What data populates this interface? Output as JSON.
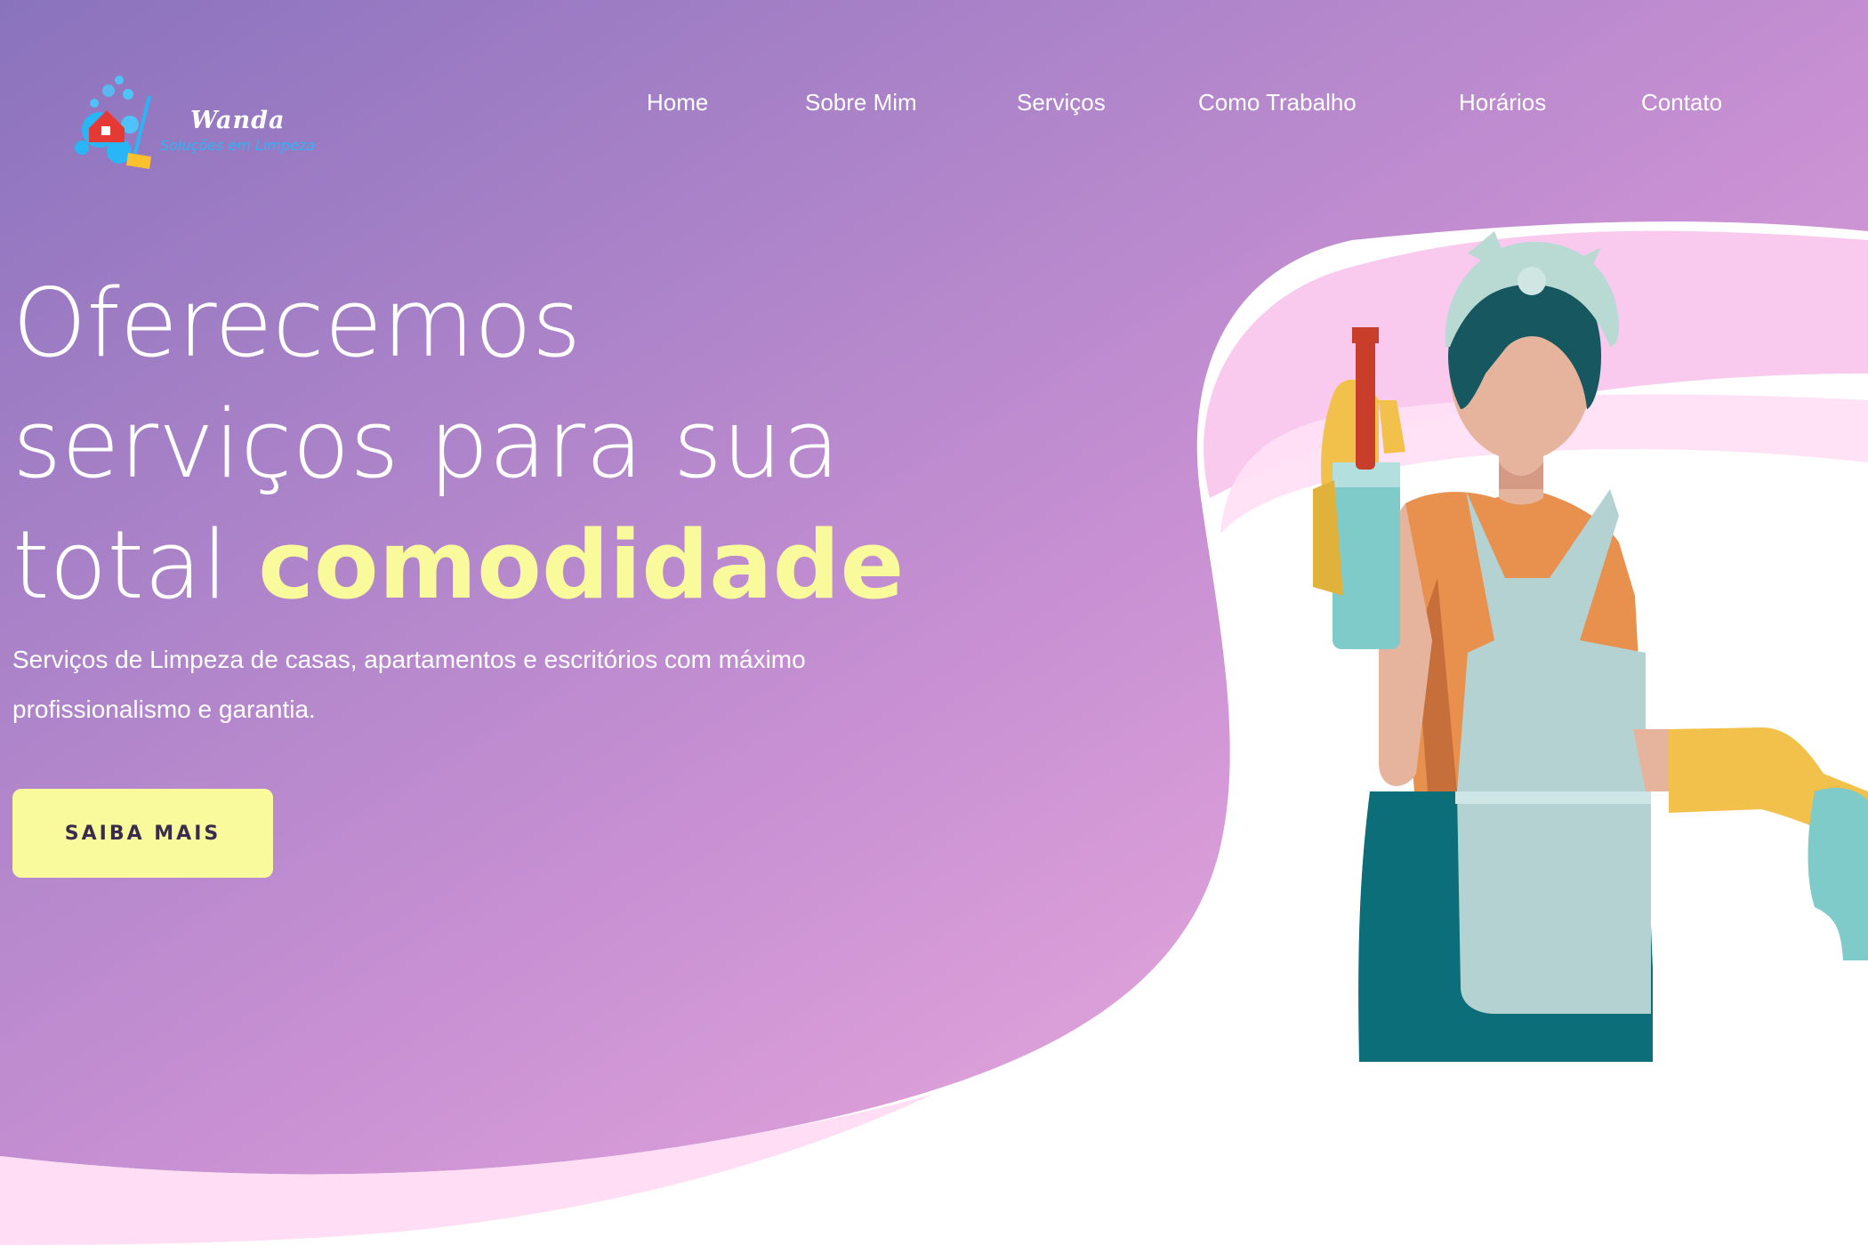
{
  "brand": {
    "name": "Wanda",
    "tagline": "Soluções em Limpeza",
    "logo_icon": "house-bubbles-broom-icon"
  },
  "nav": {
    "items": [
      {
        "label": "Home"
      },
      {
        "label": "Sobre Mim"
      },
      {
        "label": "Serviços"
      },
      {
        "label": "Como Trabalho"
      },
      {
        "label": "Horários"
      },
      {
        "label": "Contato"
      }
    ]
  },
  "hero": {
    "title_line1": "Oferecemos",
    "title_line2": "serviços para sua",
    "title_line3_plain": "total ",
    "title_line3_accent": "comodidade",
    "subtitle": "Serviços de Limpeza de casas, apartamentos e escritórios com máximo profissionalismo e garantia.",
    "cta_label": "SAIBA MAIS",
    "illustration": "cleaning-lady-illustration"
  },
  "colors": {
    "gradient_start": "#8a73bd",
    "gradient_end": "#f3aee0",
    "accent_yellow": "#f8fa9c",
    "tagline_blue": "#29b6f6",
    "button_text": "#3b2b4f"
  }
}
